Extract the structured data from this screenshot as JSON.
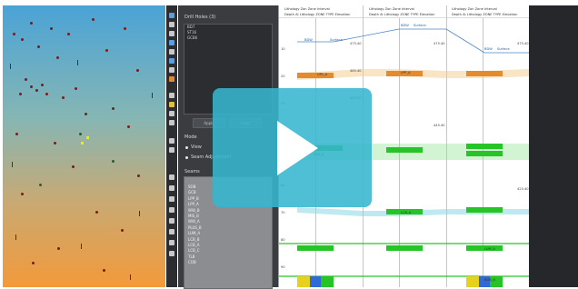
{
  "panel": {
    "title": "Drill Holes (3)",
    "holes": [
      "BD7",
      "ST16",
      "GCB6"
    ],
    "apply_label": "Apply",
    "clear_label": "Clear",
    "mode_label": "Mode",
    "mode_options": [
      "View",
      "Seam Adjustment"
    ],
    "seams_label": "Seams",
    "seams": [
      "SOB",
      "GCB",
      "LPP_B",
      "LPP_A",
      "WW_B",
      "MIS_B",
      "WW_A",
      "PLUS_B",
      "LUM_A",
      "LCB_B",
      "LCB_A",
      "LCB_C",
      "TLB",
      "COB"
    ]
  },
  "logs": {
    "columns": [
      {
        "header": "Lithology Zon Zone Interval",
        "sub": "Depth Al Lithology ZONE TYPE Elevation"
      },
      {
        "header": "Lithology Zon Zone Interval",
        "sub": "Depth Al Lithology ZONE TYPE Elevation"
      },
      {
        "header": "Lithology Zon Zone Interval",
        "sub": "Depth Al Lithology ZONE TYPE Elevation"
      }
    ],
    "top_labels": [
      "BDW",
      "Surface",
      "BDW",
      "Surface",
      "BDW",
      "Surface"
    ],
    "seam_labels": [
      "UPL_A",
      "LPP_A",
      "MIS_A",
      "WW_A",
      "LCB_A",
      "LUM_A",
      "BOB_A"
    ],
    "depths_left": [
      "5",
      "10",
      "15",
      "20",
      "25",
      "30",
      "35",
      "40",
      "45",
      "50",
      "55",
      "60",
      "65",
      "70",
      "75",
      "80",
      "85",
      "90",
      "95",
      "100",
      "105",
      "110"
    ],
    "depths_right": [
      "475.40",
      "470.40",
      "465.40",
      "460.40",
      "455.40",
      "450.40",
      "445.40",
      "440.40",
      "435.40",
      "430.40",
      "425.40",
      "420.40",
      "415.40",
      "410.40",
      "405.40",
      "400.40",
      "395.40",
      "390.40"
    ]
  },
  "colors": {
    "map_top": "#4aa3d6",
    "map_bottom": "#f39a3a",
    "seam_green": "#27c428",
    "seam_orange": "#e68a2e",
    "seam_cyan": "#7fd3e4",
    "play_overlay": "#36b6ce"
  },
  "player": {
    "icon": "play-icon"
  }
}
